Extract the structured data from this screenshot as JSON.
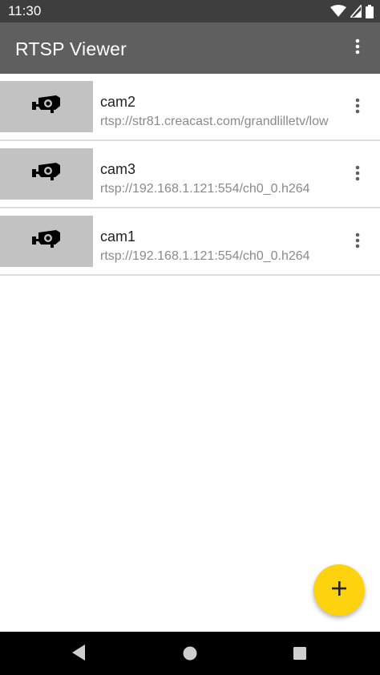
{
  "status_bar": {
    "time": "11:30",
    "icons": [
      "wifi-icon",
      "cell-signal-icon",
      "battery-icon"
    ]
  },
  "app_bar": {
    "title": "RTSP Viewer",
    "menu_icon": "more-vert-icon"
  },
  "cameras": [
    {
      "name": "cam2",
      "url": "rtsp://str81.creacast.com/grandlilletv/low",
      "thumbnail_icon": "cctv-camera-icon"
    },
    {
      "name": "cam3",
      "url": "rtsp://192.168.1.121:554/ch0_0.h264",
      "thumbnail_icon": "cctv-camera-icon"
    },
    {
      "name": "cam1",
      "url": "rtsp://192.168.1.121:554/ch0_0.h264",
      "thumbnail_icon": "cctv-camera-icon"
    }
  ],
  "fab": {
    "icon": "plus-icon"
  },
  "nav_bar": {
    "icons": [
      "back-icon",
      "home-icon",
      "recents-icon"
    ]
  },
  "colors": {
    "status_bar": "#3e3e3e",
    "app_bar": "#5f5f5f",
    "thumbnail_bg": "#c2c2c2",
    "fab": "#fdd20f",
    "nav_bar": "#000000"
  }
}
